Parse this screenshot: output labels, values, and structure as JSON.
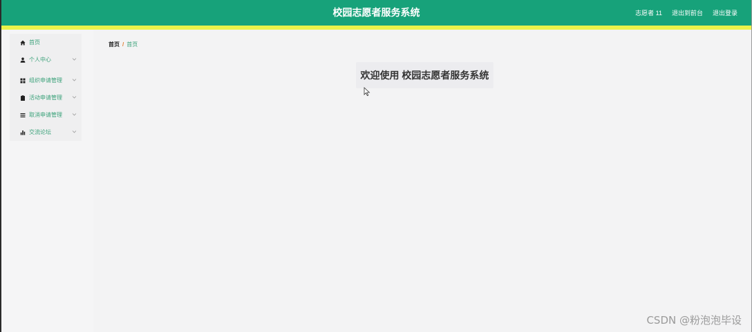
{
  "header": {
    "title": "校园志愿者服务系统",
    "user": "志愿者 11",
    "back_to_front": "退出到前台",
    "logout": "退出登录"
  },
  "sidebar": {
    "items": [
      {
        "label": "首页",
        "icon": "home-icon",
        "has_submenu": false
      },
      {
        "label": "个人中心",
        "icon": "user-icon",
        "has_submenu": true
      },
      {
        "label": "组织申请管理",
        "icon": "grid-icon",
        "has_submenu": true
      },
      {
        "label": "活动申请管理",
        "icon": "clipboard-icon",
        "has_submenu": true
      },
      {
        "label": "取消申请管理",
        "icon": "list-icon",
        "has_submenu": true
      },
      {
        "label": "交流论坛",
        "icon": "bar-chart-icon",
        "has_submenu": true
      }
    ]
  },
  "breadcrumb": {
    "home": "首页",
    "separator": "/",
    "current": "首页"
  },
  "welcome": {
    "text": "欢迎使用 校园志愿者服务系统"
  },
  "watermark": "CSDN @粉泡泡毕设",
  "colors": {
    "header_bg": "#17a27a",
    "stripe": "#eaf24a",
    "menu_text": "#3ba27a",
    "breadcrumb_sep": "#e07b2f"
  }
}
